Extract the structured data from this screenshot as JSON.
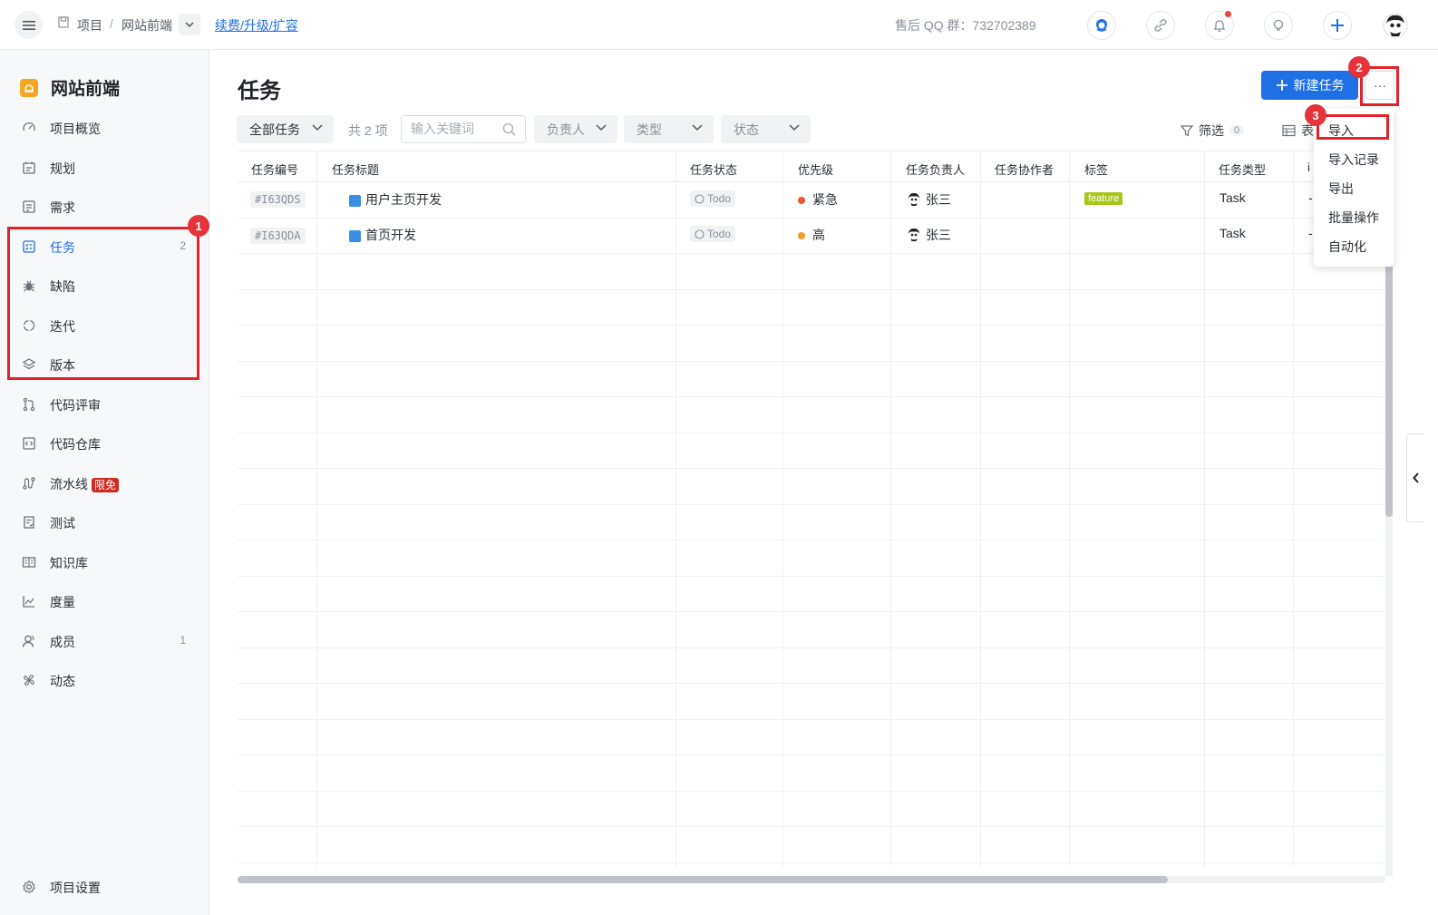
{
  "topbar": {
    "breadcrumb_root": "项目",
    "breadcrumb_sep": "/",
    "breadcrumb_project": "网站前端",
    "renew_link": "续费/升级/扩容",
    "qq_group": "售后 QQ 群：732702389"
  },
  "sidebar": {
    "project_name": "网站前端",
    "items": [
      {
        "label": "项目概览",
        "icon": "dashboard-icon"
      },
      {
        "label": "规划",
        "icon": "calendar-icon"
      },
      {
        "label": "需求",
        "icon": "requirement-icon"
      },
      {
        "label": "任务",
        "icon": "task-icon",
        "count": "2",
        "active": true
      },
      {
        "label": "缺陷",
        "icon": "bug-icon"
      },
      {
        "label": "迭代",
        "icon": "iteration-icon"
      },
      {
        "label": "版本",
        "icon": "layers-icon"
      },
      {
        "label": "代码评审",
        "icon": "merge-icon"
      },
      {
        "label": "代码仓库",
        "icon": "code-icon"
      },
      {
        "label": "流水线",
        "icon": "pipeline-icon",
        "badge": "限免"
      },
      {
        "label": "测试",
        "icon": "test-icon"
      },
      {
        "label": "知识库",
        "icon": "book-icon"
      },
      {
        "label": "度量",
        "icon": "chart-icon"
      },
      {
        "label": "成员",
        "icon": "member-icon",
        "count": "1"
      },
      {
        "label": "动态",
        "icon": "activity-icon"
      }
    ],
    "settings_label": "项目设置"
  },
  "main": {
    "title": "任务",
    "new_task_label": "新建任务",
    "more_label": "···",
    "filter_all": "全部任务",
    "count_text": "共 2 项",
    "search_placeholder": "输入关键词",
    "filter_assignee": "负责人",
    "filter_type": "类型",
    "filter_status": "状态",
    "filter_label": "筛选",
    "filter_count": "0",
    "view_label": "表"
  },
  "table": {
    "columns": [
      "任务编号",
      "任务标题",
      "任务状态",
      "优先级",
      "任务负责人",
      "任务协作者",
      "标签",
      "任务类型",
      "i"
    ],
    "rows": [
      {
        "id": "#I63QDS",
        "title": "用户主页开发",
        "status": "Todo",
        "priority": "紧急",
        "priority_color": "#f0522f",
        "assignee": "张三",
        "collaborator": "",
        "tag": "feature",
        "type": "Task",
        "extra": "-"
      },
      {
        "id": "#I63QDA",
        "title": "首页开发",
        "status": "Todo",
        "priority": "高",
        "priority_color": "#f39a2b",
        "assignee": "张三",
        "collaborator": "",
        "tag": "",
        "type": "Task",
        "extra": "-"
      }
    ]
  },
  "dropdown": {
    "items": [
      "导入",
      "导入记录",
      "导出",
      "批量操作",
      "自动化"
    ]
  },
  "annotations": {
    "badge1": "1",
    "badge2": "2",
    "badge3": "3"
  },
  "colors": {
    "accent": "#1f6fe5",
    "annotation_red": "#e4222b"
  }
}
